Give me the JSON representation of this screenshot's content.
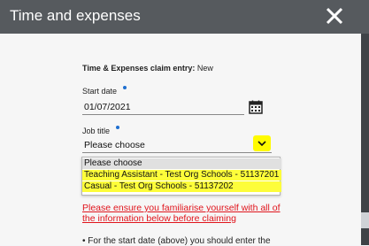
{
  "header": {
    "title": "Time and expenses"
  },
  "form": {
    "entry_label": "Time & Expenses claim entry:",
    "entry_value": "New",
    "start_date_label": "Start date",
    "start_date_value": "01/07/2021",
    "job_title_label": "Job title",
    "job_title_value": "Please choose"
  },
  "dropdown": {
    "options": [
      "Please choose",
      "Teaching Assistant - Test Org Schools - 51137201",
      "Casual - Test Org Schools - 51137202"
    ]
  },
  "warning": {
    "line1": "Please ensure you familiarise yourself with all of",
    "line2": "the information below before claiming"
  },
  "note": {
    "text": "• For the start date (above) you should enter the"
  },
  "colors": {
    "header_bg": "#565a5e",
    "highlight": "#fdfd3a",
    "warning": "#e0141c",
    "required_dot": "#1f6fd0"
  }
}
